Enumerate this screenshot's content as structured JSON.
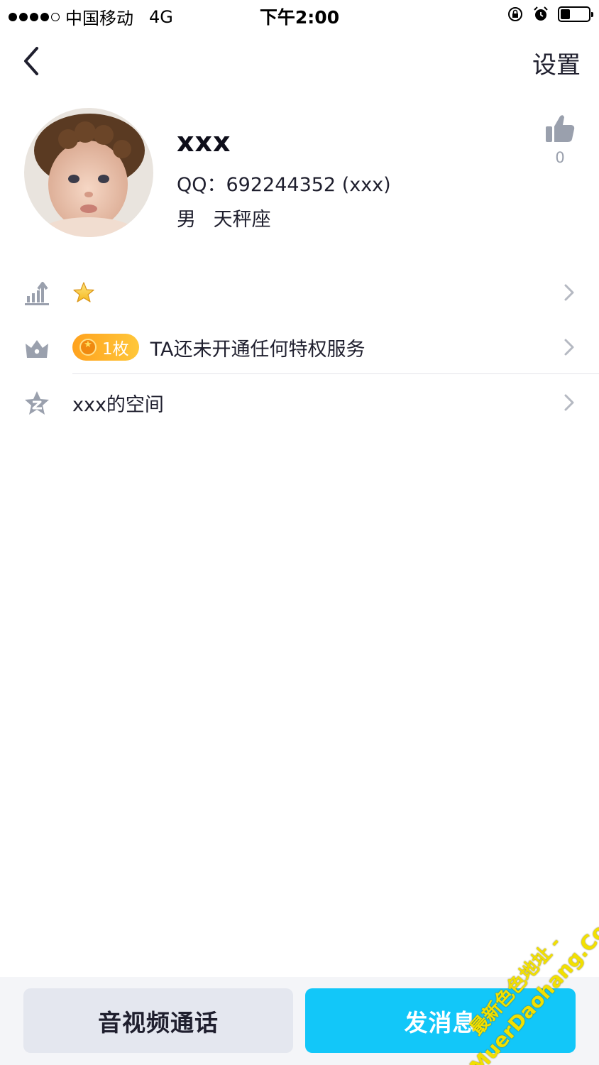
{
  "status_bar": {
    "carrier": "中国移动",
    "network": "4G",
    "time": "下午2:00",
    "battery_level": 0.35
  },
  "nav": {
    "settings_label": "设置",
    "back_icon": "chevron-left-icon"
  },
  "profile": {
    "name": "xxx",
    "qq_line": "QQ：692244352 (xxx)",
    "gender": "男",
    "zodiac": "天秤座",
    "like_count": "0",
    "like_icon": "thumbs-up-icon"
  },
  "rows": {
    "level": {
      "icon": "level-chart-icon",
      "star_icon": "star-icon"
    },
    "privilege": {
      "icon": "crown-icon",
      "badge_count": "1枚",
      "text": "TA还未开通任何特权服务"
    },
    "qzone": {
      "icon": "qzone-icon",
      "text": "xxx的空间"
    }
  },
  "bottom": {
    "call_label": "音视频通话",
    "message_label": "发消息"
  },
  "watermark": {
    "line1": "最新色色地址 -",
    "line2": "MuerDaohang.Com"
  },
  "colors": {
    "accent": "#12c7f9",
    "icon_gray": "#9aa0ad",
    "badge_orange": "#ffa21e"
  }
}
